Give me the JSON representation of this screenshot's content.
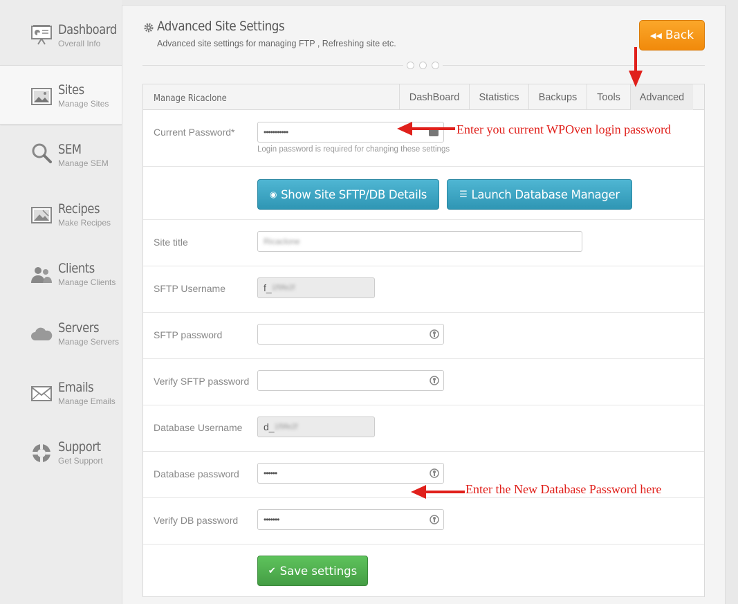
{
  "sidebar": {
    "items": [
      {
        "title": "Dashboard",
        "subtitle": "Overall Info"
      },
      {
        "title": "Sites",
        "subtitle": "Manage Sites"
      },
      {
        "title": "SEM",
        "subtitle": "Manage SEM"
      },
      {
        "title": "Recipes",
        "subtitle": "Make Recipes"
      },
      {
        "title": "Clients",
        "subtitle": "Manage Clients"
      },
      {
        "title": "Servers",
        "subtitle": "Manage Servers"
      },
      {
        "title": "Emails",
        "subtitle": "Manage Emails"
      },
      {
        "title": "Support",
        "subtitle": "Get Support"
      }
    ]
  },
  "header": {
    "title": "Advanced Site Settings",
    "subtitle": "Advanced site settings for managing FTP , Refreshing site etc.",
    "back_label": "Back"
  },
  "card": {
    "title": "Manage Ricaclone",
    "tabs": [
      "DashBoard",
      "Statistics",
      "Backups",
      "Tools",
      "Advanced"
    ],
    "active_tab": "Advanced"
  },
  "form": {
    "current_password_label": "Current Password*",
    "current_password_value": "•••••••••••",
    "current_password_help": "Login password is required for changing these settings",
    "show_details_label": "Show Site SFTP/DB Details",
    "launch_db_label": "Launch Database Manager",
    "site_title_label": "Site title",
    "site_title_value": "Ricaclone",
    "sftp_username_label": "SFTP Username",
    "sftp_username_prefix": "f_",
    "sftp_username_rest": "1f9fe2f",
    "sftp_password_label": "SFTP password",
    "sftp_password_value": "",
    "verify_sftp_label": "Verify SFTP password",
    "verify_sftp_value": "",
    "db_username_label": "Database Username",
    "db_username_prefix": "d_",
    "db_username_rest": "1f9fe2f",
    "db_password_label": "Database password",
    "db_password_value": "••••••",
    "verify_db_label": "Verify DB password",
    "verify_db_value": "•••••••",
    "save_label": "Save settings"
  },
  "annotations": {
    "current_password_note": "Enter you current WPOven login password",
    "db_password_note": "Enter the New Database Password here",
    "color": "#e0201b"
  },
  "colors": {
    "back_button": "#f39a1b",
    "info_button": "#3aa4c4",
    "success_button": "#4cae4c"
  }
}
